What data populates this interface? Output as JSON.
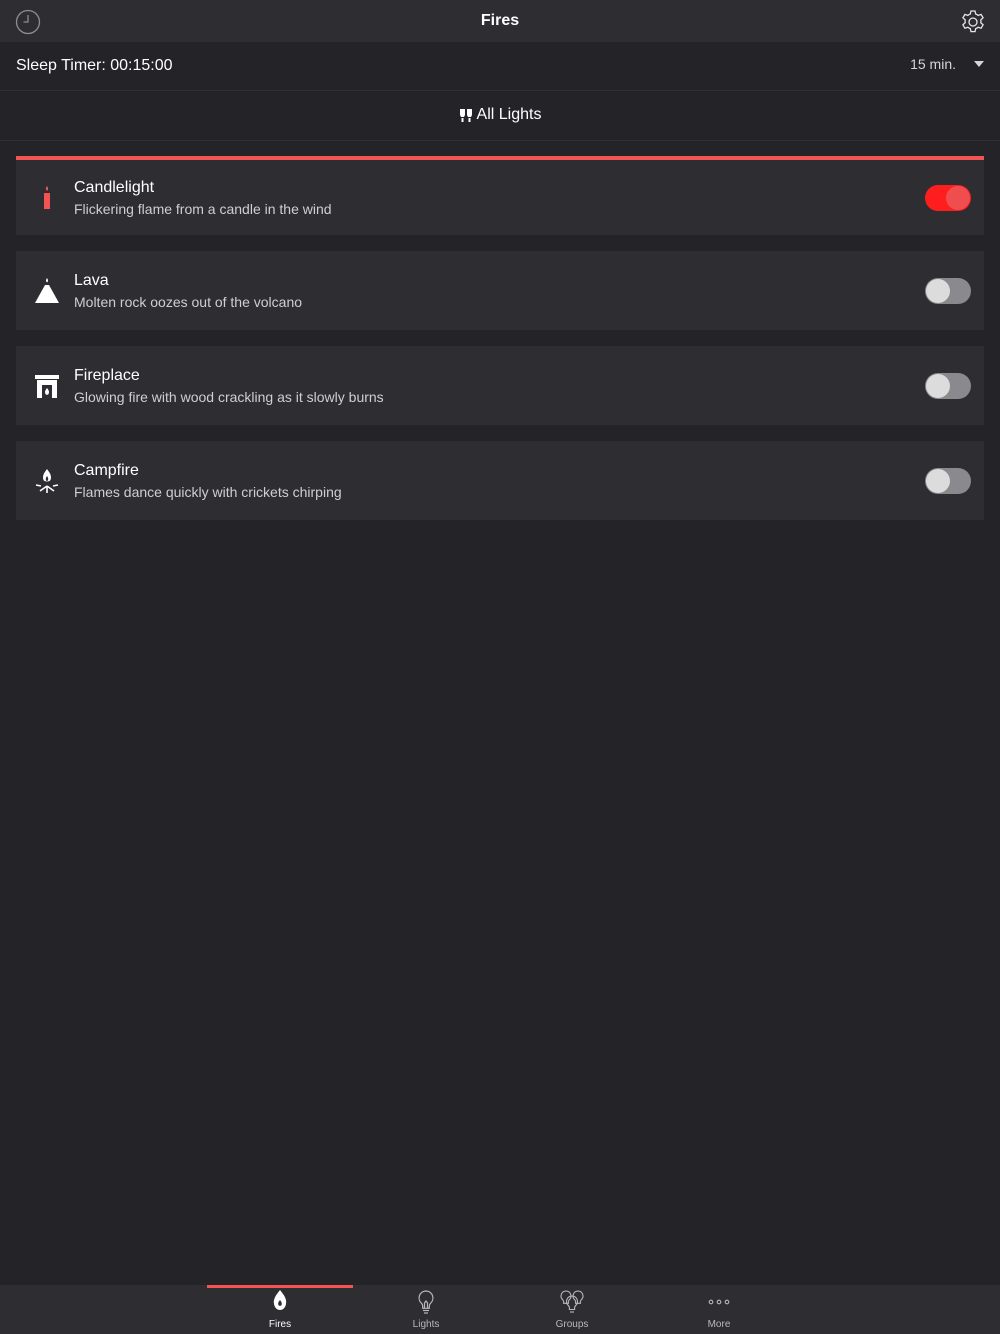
{
  "header": {
    "title": "Fires",
    "left_icon": "clock-icon",
    "right_icon": "gear-icon"
  },
  "sleep_timer": {
    "label": "Sleep Timer: 00:15:00",
    "selected": "15 min."
  },
  "all_lights": {
    "label": "All Lights",
    "icon": "lights-icon"
  },
  "fires": [
    {
      "title": "Candlelight",
      "subtitle": "Flickering flame from a candle in the wind",
      "icon": "candle-icon",
      "on": true
    },
    {
      "title": "Lava",
      "subtitle": "Molten rock oozes out of the volcano",
      "icon": "volcano-icon",
      "on": false
    },
    {
      "title": "Fireplace",
      "subtitle": "Glowing fire with wood crackling as it slowly burns",
      "icon": "fireplace-icon",
      "on": false
    },
    {
      "title": "Campfire",
      "subtitle": "Flames dance quickly with crickets chirping",
      "icon": "campfire-icon",
      "on": false
    }
  ],
  "tabs": [
    {
      "label": "Fires",
      "icon": "flame-icon",
      "selected": true
    },
    {
      "label": "Lights",
      "icon": "bulb-icon",
      "selected": false
    },
    {
      "label": "Groups",
      "icon": "bulbs-group-icon",
      "selected": false
    },
    {
      "label": "More",
      "icon": "more-icon",
      "selected": false
    }
  ],
  "colors": {
    "accent": "#f25454",
    "toggle_on": "#ff1e1e",
    "background": "#232328",
    "card": "#2d2d32"
  }
}
